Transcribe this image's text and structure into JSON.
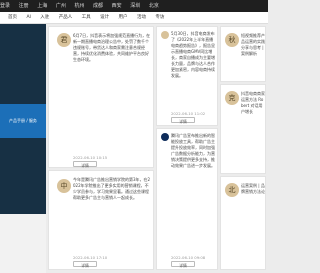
{
  "topbar": {
    "items": [
      "登录",
      "注册",
      "",
      "上海",
      "广州",
      "杭州",
      "成都",
      "西安",
      "深圳",
      "北京"
    ]
  },
  "nav": {
    "items": [
      "首页",
      "AI",
      "入驻",
      "产品人",
      "工具",
      "设计",
      "用户",
      "活动",
      "专访"
    ]
  },
  "sidebar_banner": "产品手册 / 服务",
  "cards": [
    {
      "avatar": "君",
      "text": "6月7日，抖音表示将加强规范直播行为，在新一期直播电商治理公告中，处罚了数千个违规账号，带货达人和商家需注意合规经营，持续优化消费体验，共同维护平台良好生态环境。",
      "time": "2022-06-10 10:15",
      "button": "详情"
    },
    {
      "avatar": "中",
      "text": "今年是腾讯广告推出营销学院的第3年，在2022年学院推出了更多实用的营销课程，不少学员参与，学习效果显著。通过这些课程帮助更多广告主与营销人一起成长。",
      "time": "2022-06-10 17:10",
      "button": "详情"
    },
    {
      "avatar": "",
      "text": "5月30日，抖音电商发布了《2022年上半年直播电商趋势报告》，报告显示直播电商GMV同比增长，商家自播成为主要增长力量，品牌与达人合作更加紧密，内容电商持续发展。",
      "time": "2022-06-10 11:02",
      "button": "详情"
    },
    {
      "avatar": "",
      "text": "腾讯广告宣布推出新的智能投放工具，帮助广告主提升投放效率，同时加强广告数据分析能力，为营销决策提供更多支持，推动效果广告进一步发展。",
      "time": "2022-06-10 09:08",
      "button": "详情"
    }
  ],
  "right_cards": [
    {
      "avatar": "秋",
      "text": "短视频推荐产品运营的实践分享与思考 | 案例解析"
    },
    {
      "avatar": "克",
      "text": "抖音电商商家运营方法 Robert 对话用户增长"
    },
    {
      "avatar": "北",
      "text": "运营案例 | 品牌营销方法论"
    }
  ]
}
